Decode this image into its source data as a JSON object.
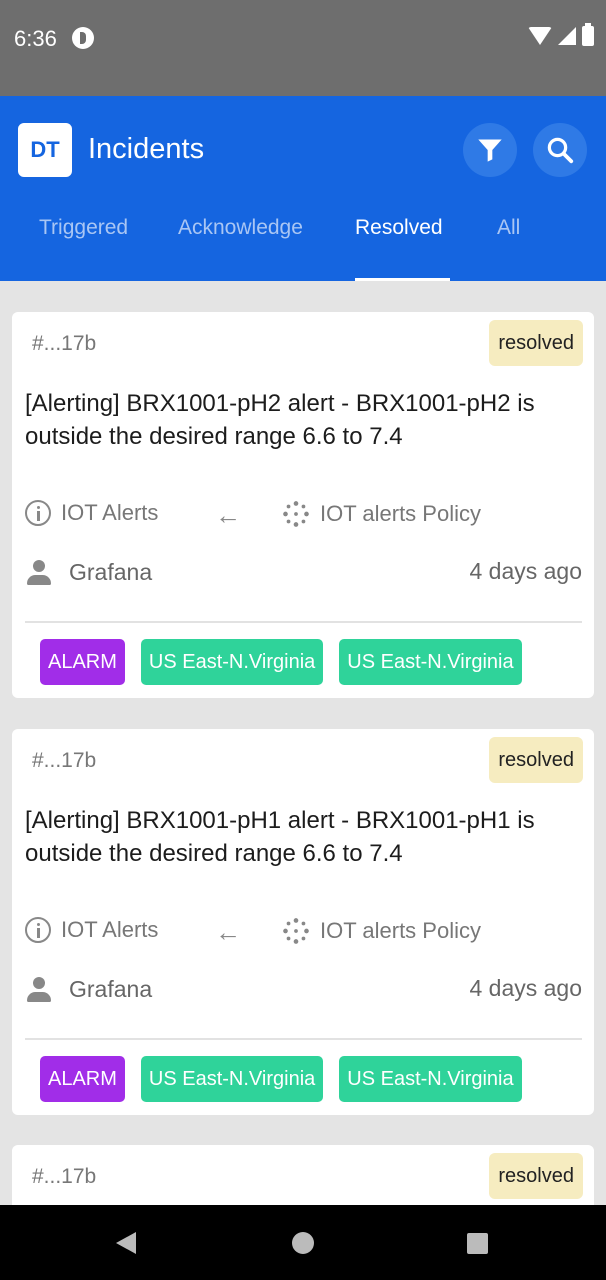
{
  "status_bar": {
    "time": "6:36"
  },
  "app_bar": {
    "logo": "DT",
    "title": "Incidents",
    "colors": {
      "primary": "#1565e0",
      "tab_inactive": "#a9c6f4"
    },
    "tabs": [
      {
        "label": "Triggered",
        "active": false
      },
      {
        "label": "Acknowledge",
        "active": false
      },
      {
        "label": "Resolved",
        "active": true
      },
      {
        "label": "All",
        "active": false
      }
    ]
  },
  "incidents": [
    {
      "id": "#...17b",
      "status": "resolved",
      "title": "[Alerting] BRX1001-pH2 alert - BRX1001-pH2 is outside the desired range 6.6 to 7.4",
      "service": "IOT Alerts",
      "policy": "IOT alerts Policy",
      "user": "Grafana",
      "time_ago": "4 days ago",
      "tags": [
        "ALARM",
        "US East-N.Virginia",
        "US East-N.Virginia"
      ]
    },
    {
      "id": "#...17b",
      "status": "resolved",
      "title": "[Alerting] BRX1001-pH1 alert - BRX1001-pH1 is outside the desired range 6.6 to 7.4",
      "service": "IOT Alerts",
      "policy": "IOT alerts Policy",
      "user": "Grafana",
      "time_ago": "4 days ago",
      "tags": [
        "ALARM",
        "US East-N.Virginia",
        "US East-N.Virginia"
      ]
    },
    {
      "id": "#...17b",
      "status": "resolved"
    }
  ],
  "tag_colors": {
    "alarm": "#a12de8",
    "region": "#2fd39a",
    "resolved_badge": "#f6ecc0"
  }
}
